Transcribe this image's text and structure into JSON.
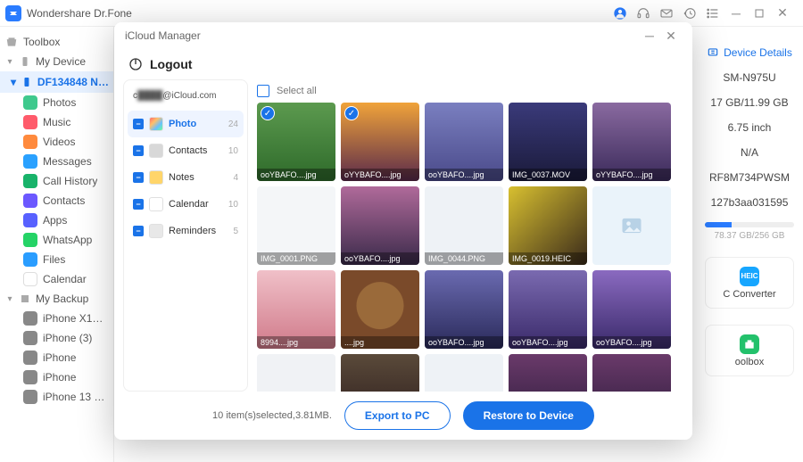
{
  "app": {
    "title": "Wondershare Dr.Fone"
  },
  "sidebar": {
    "toolbox_label": "Toolbox",
    "mydevice_label": "My Device",
    "device_name": "DF134848  Note",
    "items": [
      {
        "label": "Photos",
        "icon_bg": "#3fc98d"
      },
      {
        "label": "Music",
        "icon_bg": "#ff5b6b"
      },
      {
        "label": "Videos",
        "icon_bg": "#ff8a3d"
      },
      {
        "label": "Messages",
        "icon_bg": "#2aa1ff"
      },
      {
        "label": "Call History",
        "icon_bg": "#18b36a"
      },
      {
        "label": "Contacts",
        "icon_bg": "#6c58ff"
      },
      {
        "label": "Apps",
        "icon_bg": "#5861ff"
      },
      {
        "label": "WhatsApp",
        "icon_bg": "#25d366"
      },
      {
        "label": "Files",
        "icon_bg": "#2a9dff"
      },
      {
        "label": "Calendar",
        "icon_bg": "#ffffff"
      }
    ],
    "mybackup_label": "My Backup",
    "backups": [
      "iPhone X14.7-...",
      "iPhone (3)",
      "iPhone",
      "iPhone",
      "iPhone 13 Pro"
    ]
  },
  "details": {
    "link_label": "Device Details",
    "model": "SM-N975U",
    "storage": "17 GB/11.99 GB",
    "screen": "6.75 inch",
    "na": "N/A",
    "code1": "RF8M734PWSM",
    "code2": "127b3aa031595",
    "bar_text": "78.37 GB/256 GB",
    "card1": {
      "label": "C Converter",
      "badge": "HEIC",
      "color": "#17a6ff"
    },
    "card2": {
      "label": "oolbox",
      "color": "#23c16b"
    }
  },
  "modal": {
    "title": "iCloud Manager",
    "logout": "Logout",
    "account_suffix": "@iCloud.com",
    "categories": [
      {
        "label": "Photo",
        "count": 24,
        "active": true
      },
      {
        "label": "Contacts",
        "count": 10,
        "active": false
      },
      {
        "label": "Notes",
        "count": 4,
        "active": false
      },
      {
        "label": "Calendar",
        "count": 10,
        "active": false
      },
      {
        "label": "Reminders",
        "count": 5,
        "active": false
      }
    ],
    "select_all_label": "Select all",
    "footer": {
      "info": "10 item(s)selected,3.81MB.",
      "export": "Export to PC",
      "restore": "Restore to Device"
    },
    "thumbs": [
      {
        "fn": "ooYBAFO....jpg",
        "sel": true,
        "bg": "linear-gradient(180deg,#5c9a4f,#2e6a2a)"
      },
      {
        "fn": "oYYBAFO....jpg",
        "sel": true,
        "bg": "linear-gradient(180deg,#f0a33a,#5a2a4a)"
      },
      {
        "fn": "ooYBAFO....jpg",
        "sel": false,
        "bg": "linear-gradient(180deg,#7a7fc0,#4a4a8a)"
      },
      {
        "fn": "IMG_0037.MOV",
        "sel": false,
        "bg": "linear-gradient(180deg,#3a3a7a,#1a1a3a)"
      },
      {
        "fn": "oYYBAFO....jpg",
        "sel": false,
        "bg": "linear-gradient(180deg,#8a6aa0,#3a2a5a)"
      },
      {
        "fn": "IMG_0001.PNG",
        "sel": false,
        "bg": "#f4f6f8",
        "light": true
      },
      {
        "fn": "ooYBAFO....jpg",
        "sel": false,
        "bg": "linear-gradient(180deg,#b06a9a,#3a2a4a)"
      },
      {
        "fn": "IMG_0044.PNG",
        "sel": false,
        "bg": "#eef2f6",
        "light": true
      },
      {
        "fn": "IMG_0019.HEIC",
        "sel": false,
        "bg": "linear-gradient(135deg,#d8c030,#3a2a1a)"
      },
      {
        "fn": "",
        "sel": false,
        "bg": "#eaf3fa",
        "placeholder": true
      },
      {
        "fn": "8994....jpg",
        "sel": false,
        "bg": "linear-gradient(180deg,#f0c0c8,#d07a8a)"
      },
      {
        "fn": "....jpg",
        "sel": false,
        "bg": "radial-gradient(circle at 50% 45%,#9a6a3a 40%,#7a4a2a 41%)"
      },
      {
        "fn": "ooYBAFO....jpg",
        "sel": false,
        "bg": "linear-gradient(180deg,#6a6ab0,#2a2a5a)"
      },
      {
        "fn": "ooYBAFO....jpg",
        "sel": false,
        "bg": "linear-gradient(180deg,#7a6ab0,#3a2a6a)"
      },
      {
        "fn": "ooYBAFO....jpg",
        "sel": false,
        "bg": "linear-gradient(180deg,#8a6ac0,#3a2a6a)"
      },
      {
        "fn": "",
        "sel": false,
        "bg": "#f0f2f5",
        "light": true
      },
      {
        "fn": "",
        "sel": false,
        "bg": "linear-gradient(180deg,#5a4a3a,#2a1a1a)"
      },
      {
        "fn": "",
        "sel": false,
        "bg": "#eef2f6",
        "light": true
      },
      {
        "fn": "",
        "sel": false,
        "bg": "linear-gradient(180deg,#6a3a6a,#2a1a3a)"
      },
      {
        "fn": "",
        "sel": false,
        "bg": "linear-gradient(180deg,#6a3a6a,#2a1a3a)"
      }
    ]
  }
}
